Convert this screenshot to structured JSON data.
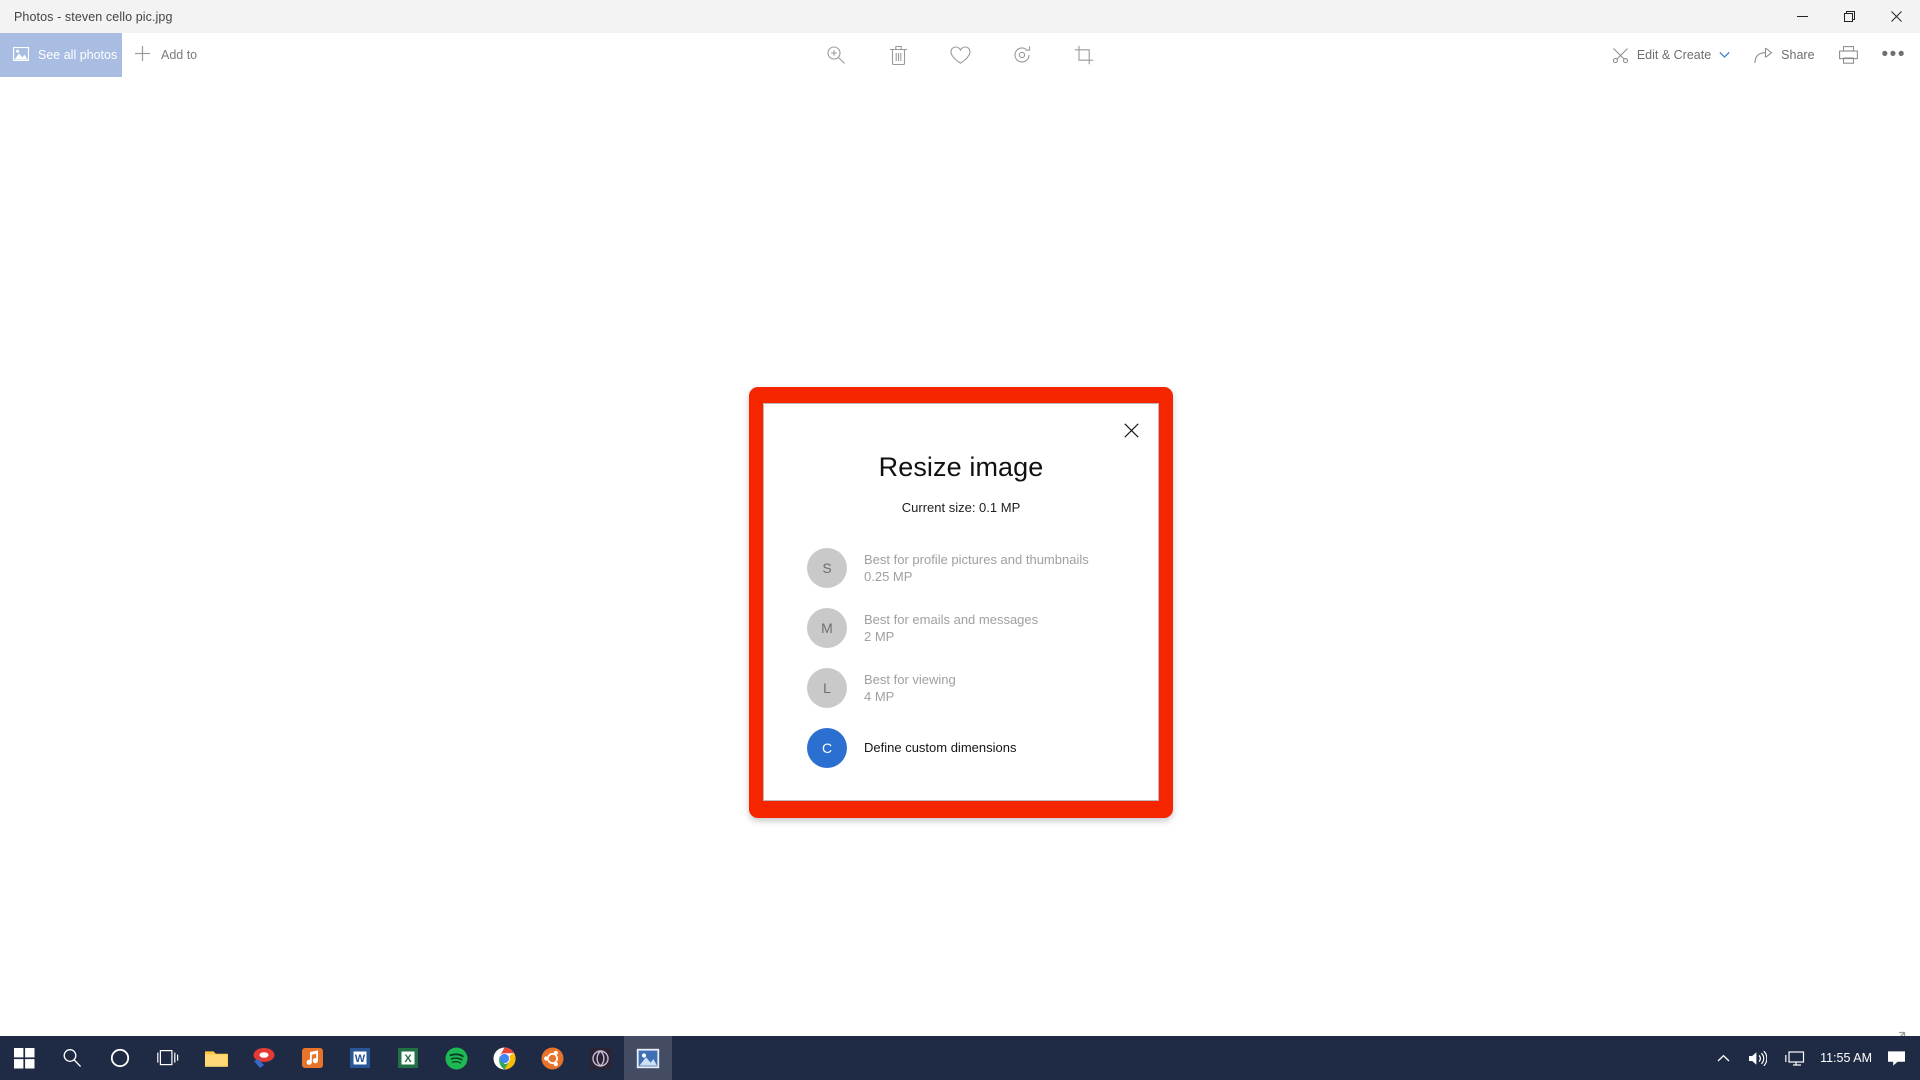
{
  "window": {
    "title": "Photos - steven cello pic.jpg",
    "controls": [
      {
        "name": "minimize",
        "glyph": "minimize-icon"
      },
      {
        "name": "restore",
        "glyph": "restore-icon"
      },
      {
        "name": "close",
        "glyph": "close-icon"
      }
    ]
  },
  "commandbar": {
    "see_all_photos": "See all photos",
    "add_to": "Add to",
    "center_tools": [
      {
        "label": "Zoom",
        "icon": "zoom-in-icon"
      },
      {
        "label": "Delete",
        "icon": "trash-icon"
      },
      {
        "label": "Add to favorites",
        "icon": "heart-icon"
      },
      {
        "label": "Rotate",
        "icon": "rotate-icon"
      },
      {
        "label": "Crop & rotate",
        "icon": "crop-icon"
      }
    ],
    "edit_create": "Edit & Create",
    "share": "Share",
    "print_icon": "print-icon",
    "more_icon": "more-options-icon"
  },
  "dialog": {
    "title": "Resize image",
    "subtitle": "Current size: 0.1 MP",
    "close_icon": "close-icon",
    "border_color": "#f52500",
    "accent_color": "#2b6fd1",
    "options": [
      {
        "letter": "S",
        "title": "Best for profile pictures and thumbnails",
        "size": "0.25 MP",
        "enabled": false
      },
      {
        "letter": "M",
        "title": "Best for emails and messages",
        "size": "2 MP",
        "enabled": false
      },
      {
        "letter": "L",
        "title": "Best for viewing",
        "size": "4 MP",
        "enabled": false
      },
      {
        "letter": "C",
        "title": "Define custom dimensions",
        "size": "",
        "enabled": true
      }
    ]
  },
  "taskbar": {
    "items": [
      {
        "name": "start-button",
        "icon": "windows-logo-icon"
      },
      {
        "name": "search-button",
        "icon": "search-icon"
      },
      {
        "name": "cortana-button",
        "icon": "cortana-circle-icon"
      },
      {
        "name": "task-view-button",
        "icon": "task-view-icon"
      },
      {
        "name": "file-explorer",
        "icon": "folder-icon"
      },
      {
        "name": "paint-app",
        "icon": "paint-icon"
      },
      {
        "name": "music-app",
        "icon": "music-note-icon"
      },
      {
        "name": "word-app",
        "icon": "word-icon",
        "letter": "W"
      },
      {
        "name": "excel-app",
        "icon": "excel-icon",
        "letter": "X"
      },
      {
        "name": "spotify-app",
        "icon": "spotify-icon"
      },
      {
        "name": "chrome-app",
        "icon": "chrome-icon"
      },
      {
        "name": "ubuntu-app",
        "icon": "ubuntu-icon"
      },
      {
        "name": "game-app",
        "icon": "game-icon"
      },
      {
        "name": "photos-app",
        "icon": "photos-icon",
        "active": true
      }
    ],
    "tray": {
      "show_hidden_icon": "chevron-up-icon",
      "volume_icon": "speaker-icon",
      "network_icon": "network-display-icon",
      "time": "11:55 AM",
      "notifications_icon": "notification-icon"
    }
  }
}
